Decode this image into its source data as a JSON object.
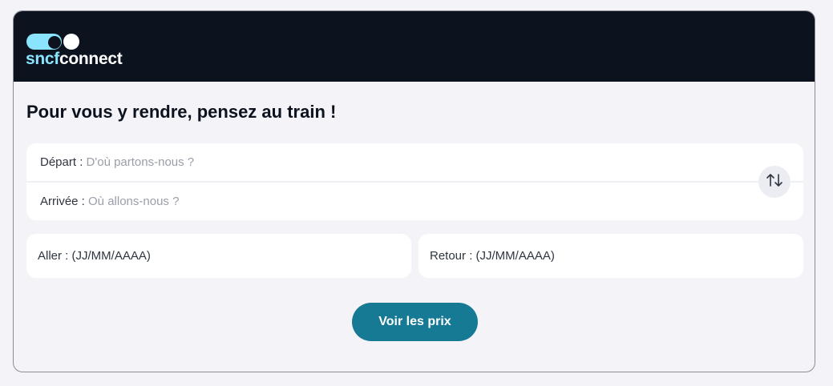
{
  "brand": {
    "logo_part1": "sncf",
    "logo_part2": "connect"
  },
  "title": "Pour vous y rendre, pensez au train !",
  "origin": {
    "label": "Départ : ",
    "placeholder": "D'où partons-nous ?"
  },
  "destination": {
    "label": "Arrivée : ",
    "placeholder": "Où allons-nous ?"
  },
  "swap_icon": "swap-arrows-icon",
  "dates": {
    "outbound": "Aller : (JJ/MM/AAAA)",
    "return": "Retour : (JJ/MM/AAAA)"
  },
  "cta_label": "Voir les prix",
  "colors": {
    "header_bg": "#0c131f",
    "brand_accent": "#8ae4fd",
    "cta_bg": "#167a94",
    "page_bg": "#f3f3f8"
  }
}
